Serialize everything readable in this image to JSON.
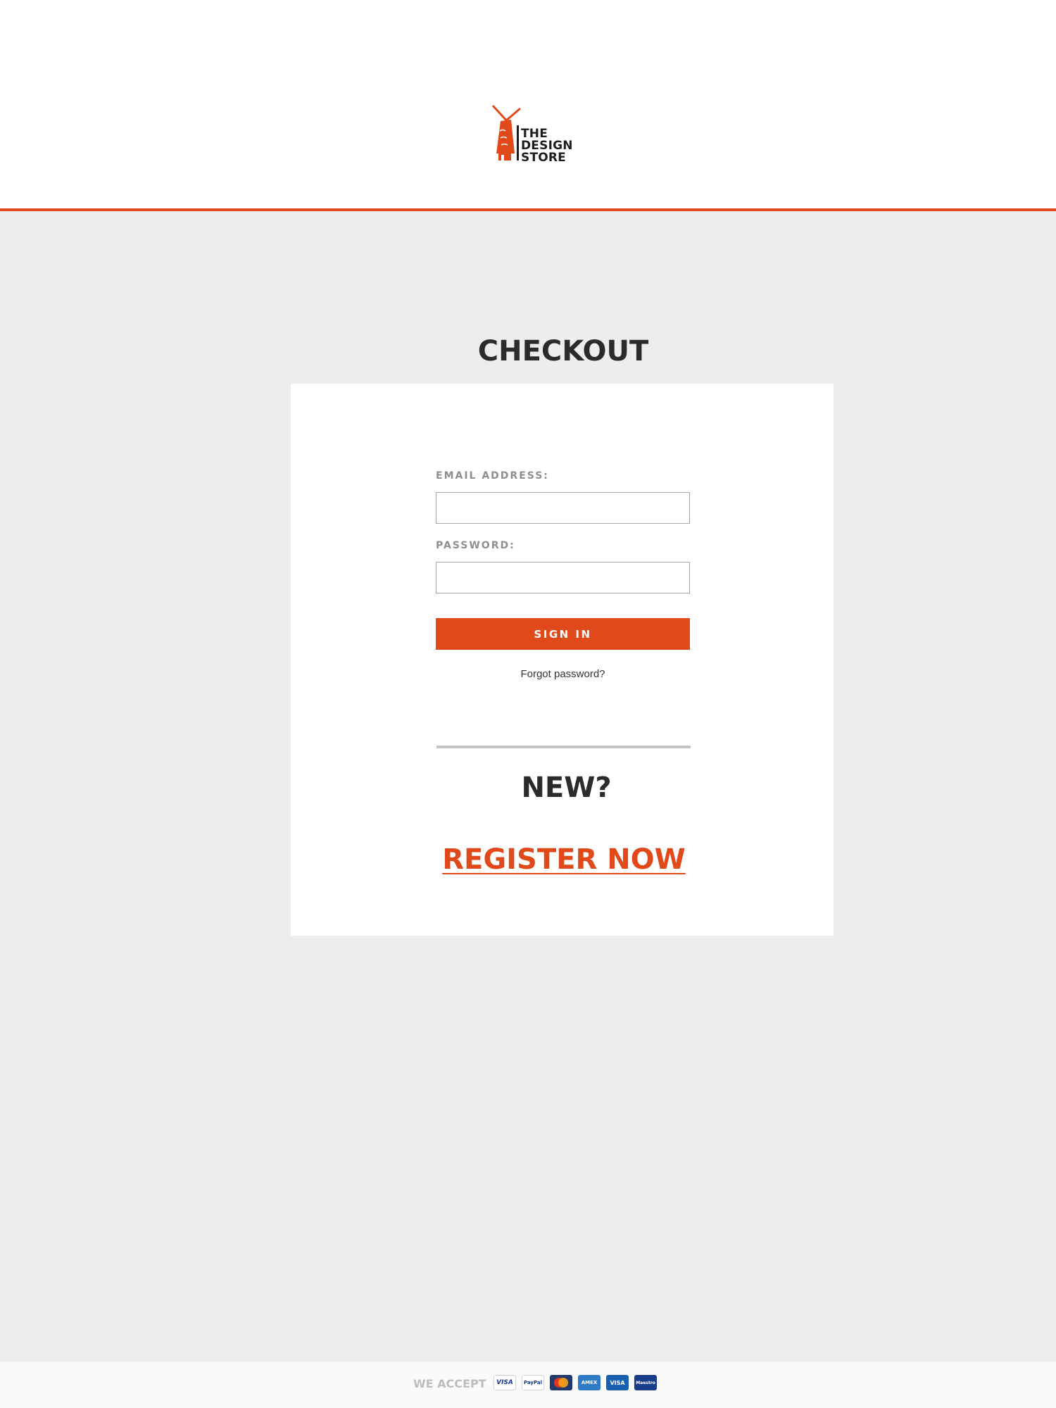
{
  "brand": {
    "logo_lines": [
      "THE",
      "DESIGN",
      "STORE"
    ],
    "accent_color": "#e04a1a"
  },
  "page": {
    "title": "CHECKOUT"
  },
  "login": {
    "email_label": "EMAIL ADDRESS:",
    "email_value": "",
    "password_label": "PASSWORD:",
    "password_value": "",
    "sign_in_label": "SIGN IN",
    "forgot_label": "Forgot password?"
  },
  "register": {
    "heading": "NEW?",
    "link_label": "REGISTER NOW"
  },
  "footer": {
    "we_accept_label": "WE ACCEPT",
    "payment_cards": [
      {
        "name": "visa-card-icon",
        "label": "VISA"
      },
      {
        "name": "paypal-card-icon",
        "label": "PayPal"
      },
      {
        "name": "mastercard-card-icon",
        "label": "mastercard"
      },
      {
        "name": "amex-card-icon",
        "label": "AMEX"
      },
      {
        "name": "visa-electron-card-icon",
        "label": "VISA"
      },
      {
        "name": "maestro-card-icon",
        "label": "Maestro"
      }
    ]
  }
}
